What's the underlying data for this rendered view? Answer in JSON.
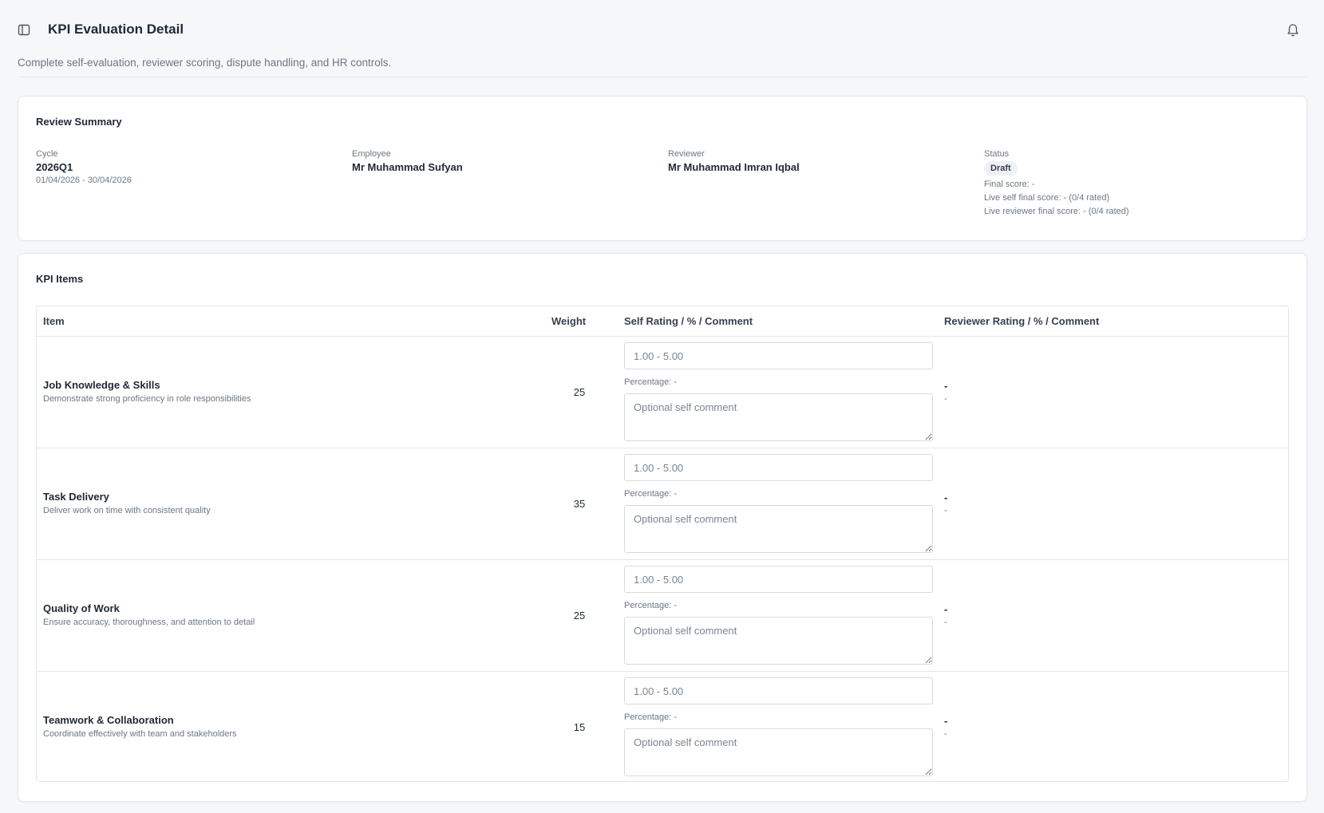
{
  "header": {
    "title": "KPI Evaluation Detail",
    "subtitle": "Complete self-evaluation, reviewer scoring, dispute handling, and HR controls.",
    "sidebar_toggle_icon": "panel-left-icon",
    "notification_icon": "bell-icon"
  },
  "summary": {
    "title": "Review Summary",
    "cycle_label": "Cycle",
    "cycle_value": "2026Q1",
    "cycle_range": "01/04/2026 - 30/04/2026",
    "employee_label": "Employee",
    "employee_value": "Mr Muhammad Sufyan",
    "reviewer_label": "Reviewer",
    "reviewer_value": "Mr Muhammad Imran Iqbal",
    "status_label": "Status",
    "status_value": "Draft",
    "final_score": "Final score: -",
    "live_self_score": "Live self final score: - (0/4 rated)",
    "live_reviewer_score": "Live reviewer final score: - (0/4 rated)"
  },
  "kpi": {
    "title": "KPI Items",
    "columns": {
      "item": "Item",
      "weight": "Weight",
      "self": "Self Rating / % / Comment",
      "reviewer": "Reviewer Rating / % / Comment"
    },
    "rating_placeholder": "1.00 - 5.00",
    "comment_placeholder": "Optional self comment",
    "items": [
      {
        "name": "Job Knowledge & Skills",
        "description": "Demonstrate strong proficiency in role responsibilities",
        "weight": "25",
        "self_percentage": "Percentage: -",
        "reviewer_rating": "-",
        "reviewer_percentage": "-"
      },
      {
        "name": "Task Delivery",
        "description": "Deliver work on time with consistent quality",
        "weight": "35",
        "self_percentage": "Percentage: -",
        "reviewer_rating": "-",
        "reviewer_percentage": "-"
      },
      {
        "name": "Quality of Work",
        "description": "Ensure accuracy, thoroughness, and attention to detail",
        "weight": "25",
        "self_percentage": "Percentage: -",
        "reviewer_rating": "-",
        "reviewer_percentage": "-"
      },
      {
        "name": "Teamwork & Collaboration",
        "description": "Coordinate effectively with team and stakeholders",
        "weight": "15",
        "self_percentage": "Percentage: -",
        "reviewer_rating": "-",
        "reviewer_percentage": "-"
      }
    ]
  }
}
